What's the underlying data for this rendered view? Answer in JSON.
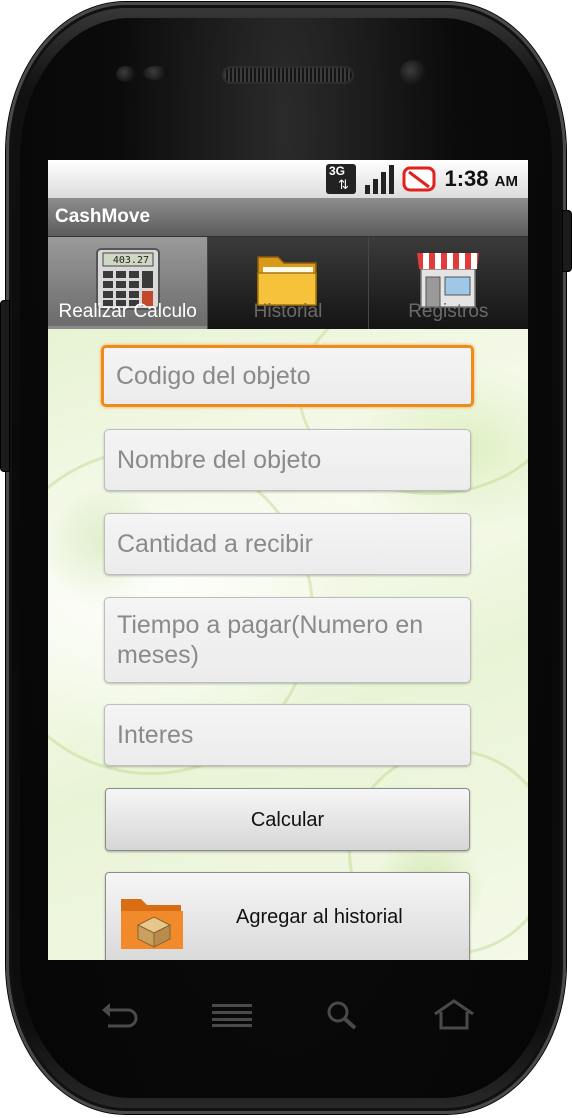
{
  "status_bar": {
    "network_label": "3G",
    "clock_time": "1:38",
    "clock_ampm": "AM",
    "icons": [
      "3g-data-icon",
      "signal-bars-icon",
      "no-sync-icon"
    ]
  },
  "app": {
    "title": "CashMove"
  },
  "tabs": [
    {
      "label": "Realizar Calculo",
      "icon": "calculator-icon",
      "active": true,
      "display_value": "403.27"
    },
    {
      "label": "Historial",
      "icon": "folder-icon",
      "active": false
    },
    {
      "label": "Registros",
      "icon": "store-icon",
      "active": false
    }
  ],
  "form": {
    "codigo": {
      "placeholder": "Codigo del objeto",
      "value": ""
    },
    "nombre": {
      "placeholder": "Nombre del objeto",
      "value": ""
    },
    "cantidad": {
      "placeholder": "Cantidad a recibir",
      "value": ""
    },
    "tiempo": {
      "placeholder": "Tiempo a pagar(Numero en meses)",
      "value": ""
    },
    "interes": {
      "placeholder": "Interes",
      "value": ""
    }
  },
  "buttons": {
    "calcular": "Calcular",
    "agregar": "Agregar al historial"
  },
  "nav_keys": [
    "back-icon",
    "menu-icon",
    "search-icon",
    "home-icon"
  ],
  "colors": {
    "focus_orange": "#f08a1c",
    "title_gray": "#6e6e6e",
    "tab_active": "#8a8a8a"
  }
}
